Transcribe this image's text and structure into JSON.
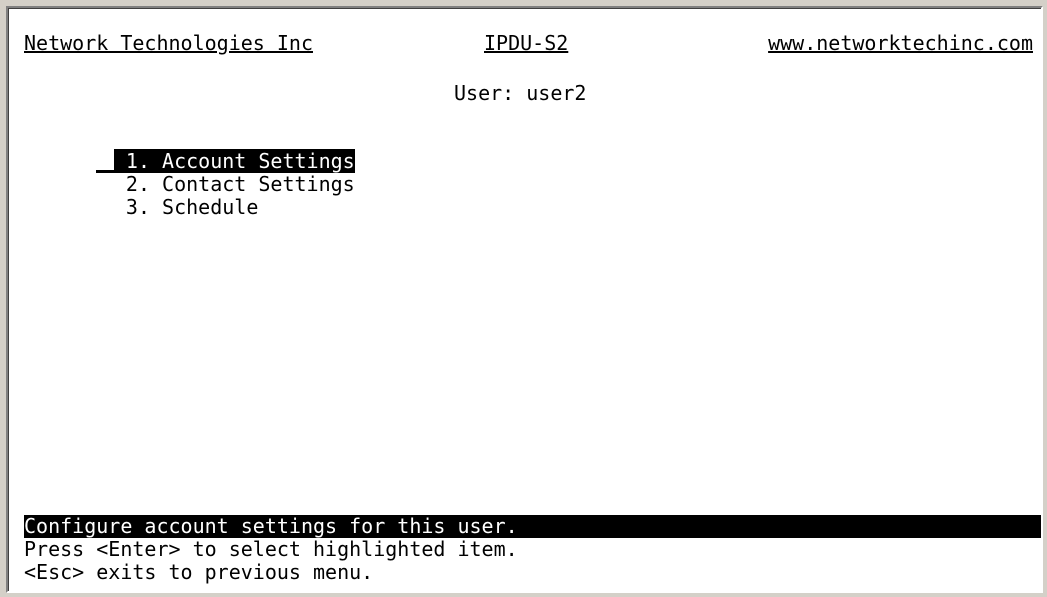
{
  "header": {
    "company": "Network Technologies Inc",
    "model": "IPDU-S2",
    "website": "www.networktechinc.com"
  },
  "user": {
    "label": "User: user2"
  },
  "menu": {
    "selected_index": 0,
    "items": [
      {
        "number": "1.",
        "label": "Account Settings"
      },
      {
        "number": "2.",
        "label": "Contact Settings"
      },
      {
        "number": "3.",
        "label": "Schedule"
      }
    ]
  },
  "footer": {
    "status": "Configure account settings for this user.",
    "hint_enter": "Press <Enter> to select highlighted item.",
    "hint_esc": "<Esc> exits to previous menu."
  }
}
